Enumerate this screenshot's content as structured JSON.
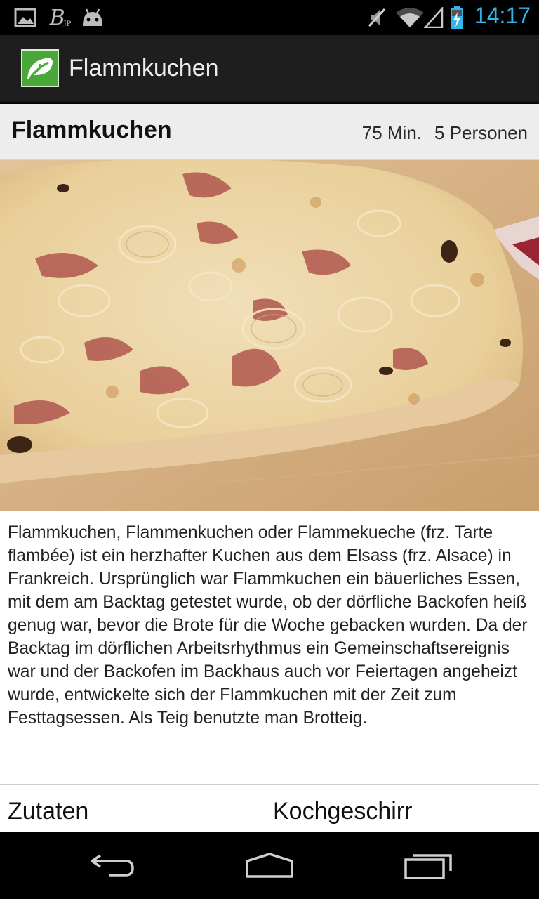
{
  "status_bar": {
    "time": "14:17",
    "icons": [
      "image-icon",
      "bitcoin-jp-icon",
      "android-icon",
      "mute-icon",
      "wifi-icon",
      "signal-icon",
      "battery-charging-icon"
    ],
    "time_color": "#33b5e5"
  },
  "action_bar": {
    "title": "Flammkuchen",
    "logo_icon": "leaf-logo-icon",
    "accent": "#4aa83a"
  },
  "recipe": {
    "title": "Flammkuchen",
    "duration": "75 Min.",
    "servings": "5 Personen",
    "image_alt": "Flammkuchen photo",
    "description": "Flammkuchen, Flammenkuchen oder Flammekueche (frz. Tarte flambée) ist ein herzhafter Kuchen aus dem Elsass (frz. Alsace) in Frankreich. Ursprünglich war Flammkuchen ein bäuerliches Essen, mit dem am Backtag getestet wurde, ob der dörfliche Backofen heiß genug war, bevor die Brote für die Woche gebacken wurden. Da der Backtag im dörflichen Arbeitsrhythmus ein Gemeinschaftsereignis war und der Backofen im Backhaus auch vor Feiertagen angeheizt wurde, entwickelte sich der Flammkuchen mit der Zeit zum Festtagsessen. Als Teig benutzte man Brotteig."
  },
  "sections": {
    "ingredients": "Zutaten",
    "cookware": "Kochgeschirr"
  },
  "nav_bar": {
    "buttons": [
      "back-icon",
      "home-icon",
      "recent-apps-icon"
    ]
  }
}
